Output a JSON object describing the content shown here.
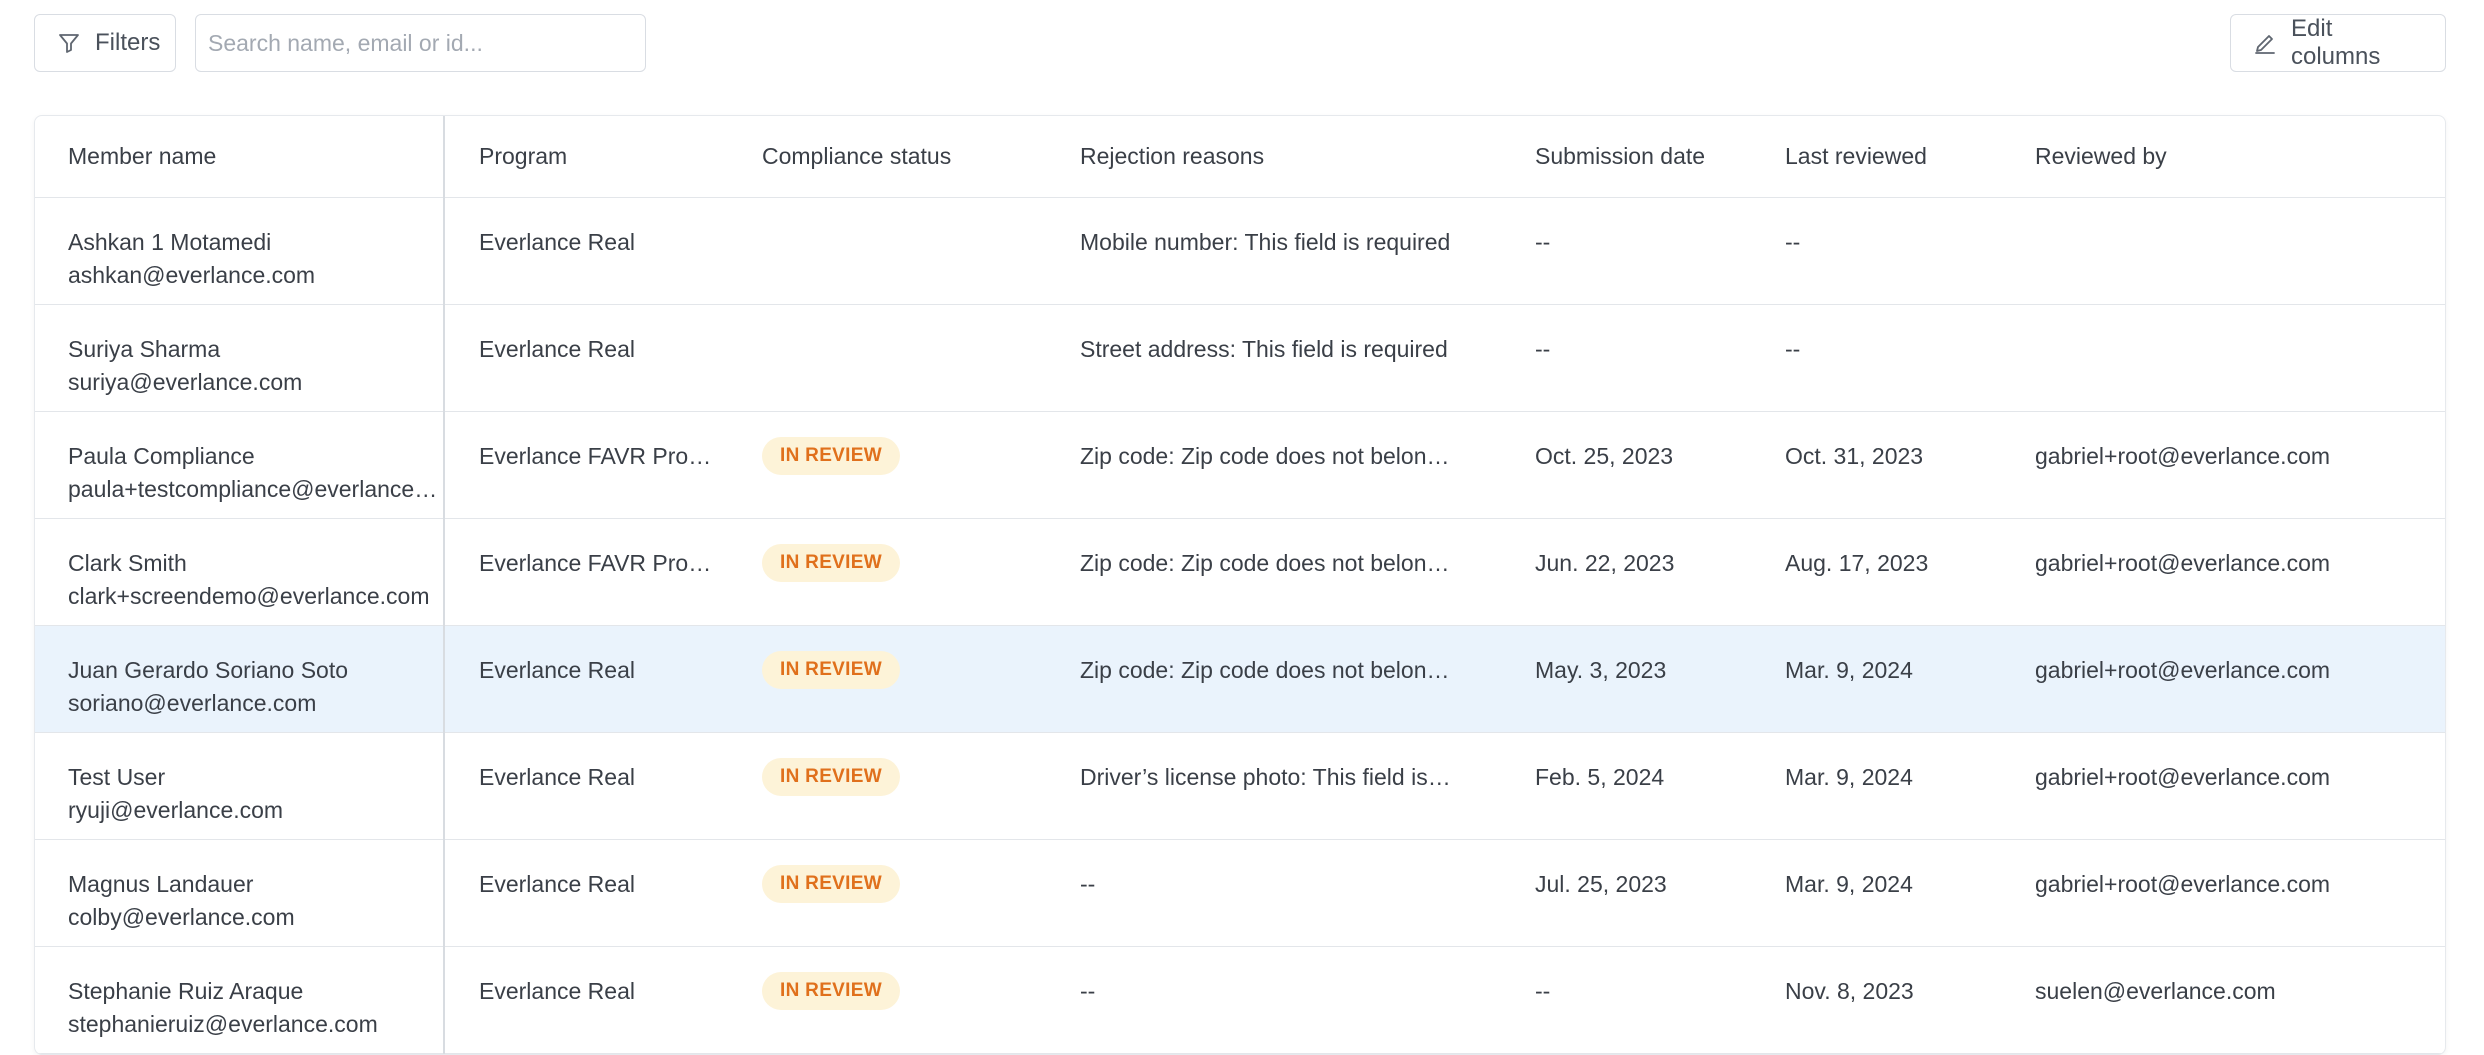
{
  "toolbar": {
    "filters_label": "Filters",
    "search_placeholder": "Search name, email or id...",
    "edit_columns_label": "Edit columns"
  },
  "table": {
    "headers": {
      "member_name": "Member name",
      "program": "Program",
      "compliance_status": "Compliance status",
      "rejection_reasons": "Rejection reasons",
      "submission_date": "Submission date",
      "last_reviewed": "Last reviewed",
      "reviewed_by": "Reviewed by"
    },
    "rows": [
      {
        "name": "Ashkan 1 Motamedi",
        "email": "ashkan@everlance.com",
        "program": "Everlance Real",
        "status": "",
        "rejection": "Mobile number: This field is required",
        "submitted": "--",
        "last_reviewed": "--",
        "reviewed_by": ""
      },
      {
        "name": "Suriya Sharma",
        "email": "suriya@everlance.com",
        "program": "Everlance Real",
        "status": "",
        "rejection": "Street address: This field is required",
        "submitted": "--",
        "last_reviewed": "--",
        "reviewed_by": ""
      },
      {
        "name": "Paula Compliance",
        "email": "paula+testcompliance@everlance.com",
        "program": "Everlance FAVR Program",
        "status": "IN REVIEW",
        "rejection": "Zip code: Zip code does not belong to the selected state",
        "submitted": "Oct. 25, 2023",
        "last_reviewed": "Oct. 31, 2023",
        "reviewed_by": "gabriel+root@everlance.com"
      },
      {
        "name": "Clark Smith",
        "email": "clark+screendemo@everlance.com",
        "program": "Everlance FAVR Program",
        "status": "IN REVIEW",
        "rejection": "Zip code: Zip code does not belong to the selected state",
        "submitted": "Jun. 22, 2023",
        "last_reviewed": "Aug. 17, 2023",
        "reviewed_by": "gabriel+root@everlance.com"
      },
      {
        "name": "Juan Gerardo Soriano Soto",
        "email": "soriano@everlance.com",
        "program": "Everlance Real",
        "status": "IN REVIEW",
        "rejection": "Zip code: Zip code does not belong to the selected state",
        "submitted": "May. 3, 2023",
        "last_reviewed": "Mar. 9, 2024",
        "reviewed_by": "gabriel+root@everlance.com",
        "selected": true
      },
      {
        "name": "Test User",
        "email": "ryuji@everlance.com",
        "program": "Everlance Real",
        "status": "IN REVIEW",
        "rejection": "Driver’s license photo: This field is required",
        "submitted": "Feb. 5, 2024",
        "last_reviewed": "Mar. 9, 2024",
        "reviewed_by": "gabriel+root@everlance.com"
      },
      {
        "name": "Magnus Landauer",
        "email": "colby@everlance.com",
        "program": "Everlance Real",
        "status": "IN REVIEW",
        "rejection": "--",
        "submitted": "Jul. 25, 2023",
        "last_reviewed": "Mar. 9, 2024",
        "reviewed_by": "gabriel+root@everlance.com"
      },
      {
        "name": "Stephanie  Ruiz Araque",
        "email": "stephanieruiz@everlance.com",
        "program": "Everlance Real",
        "status": "IN REVIEW",
        "rejection": "--",
        "submitted": "--",
        "last_reviewed": "Nov. 8, 2023",
        "reviewed_by": "suelen@everlance.com"
      }
    ]
  },
  "colors": {
    "badge_bg": "#fdf3d8",
    "badge_text": "#e0701c",
    "selected_row": "#eaf3fc"
  }
}
